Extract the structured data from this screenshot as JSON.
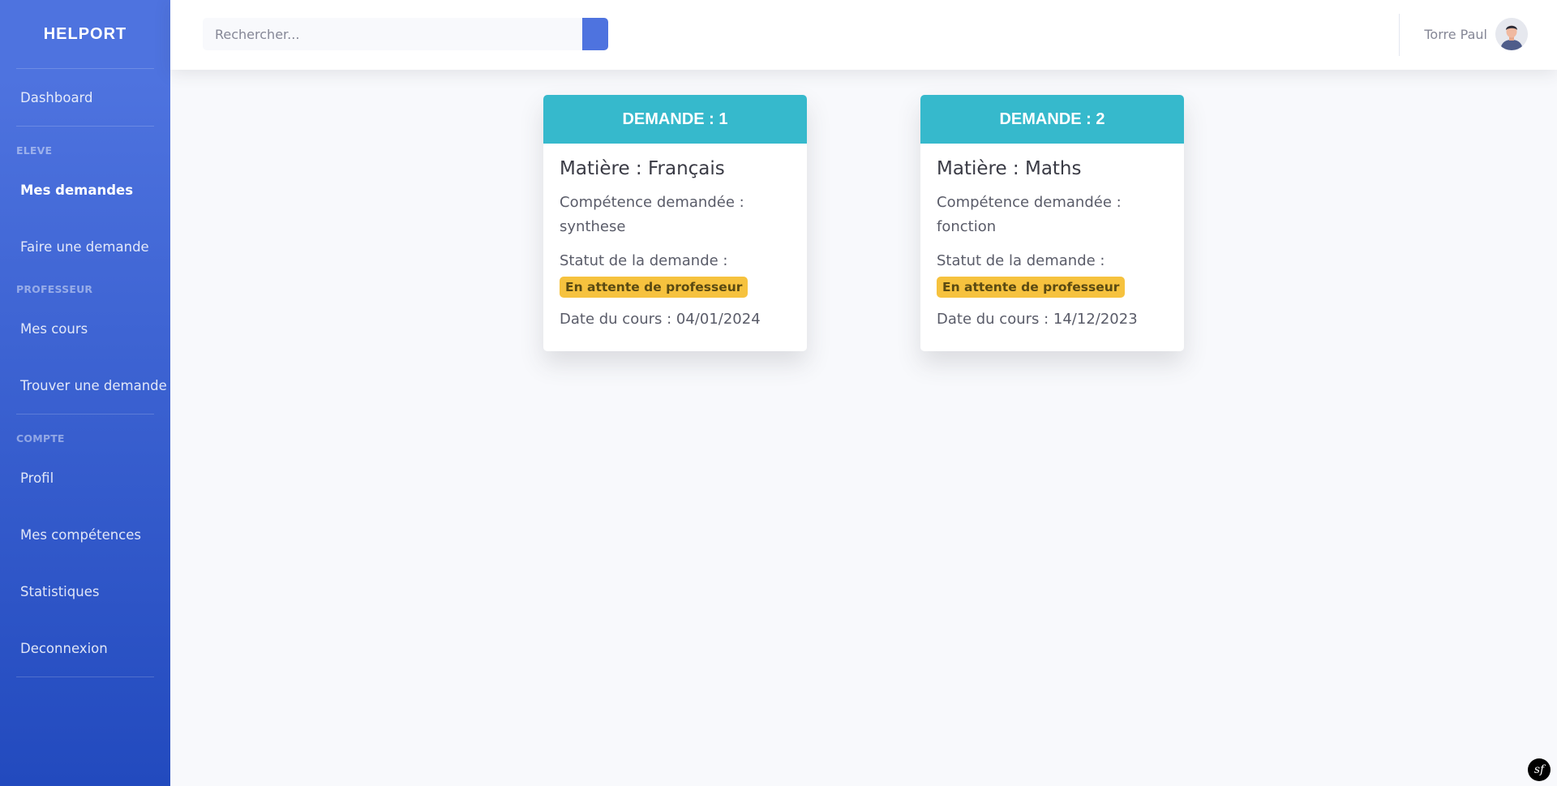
{
  "sidebar": {
    "brand": "HELPORT",
    "dashboard": "Dashboard",
    "eleve_heading": "ELEVE",
    "mes_demandes": "Mes demandes",
    "faire_demande": "Faire une demande",
    "professeur_heading": "PROFESSEUR",
    "mes_cours": "Mes cours",
    "trouver_demande": "Trouver une demande",
    "compte_heading": "COMPTE",
    "profil": "Profil",
    "mes_competences": "Mes compétences",
    "statistiques": "Statistiques",
    "deconnexion": "Deconnexion"
  },
  "topbar": {
    "search_placeholder": "Rechercher...",
    "user_name": "Torre Paul"
  },
  "cards": [
    {
      "header": "DEMANDE : 1",
      "subject": "Matière : Français",
      "competence_label": "Compétence demandée :",
      "competence_value": "synthese",
      "statut_label": "Statut de la demande :",
      "statut_badge": "En attente de professeur",
      "date": "Date du cours : 04/01/2024"
    },
    {
      "header": "DEMANDE : 2",
      "subject": "Matière : Maths",
      "competence_label": "Compétence demandée :",
      "competence_value": "fonction",
      "statut_label": "Statut de la demande :",
      "statut_badge": "En attente de professeur",
      "date": "Date du cours : 14/12/2023"
    }
  ],
  "colors": {
    "sidebar_top": "#4e73df",
    "sidebar_bottom": "#224abe",
    "card_header": "#36b9cc",
    "badge": "#f6c23e"
  },
  "footer": {
    "symfony_icon": "symfony-icon",
    "symfony_glyph": "sf"
  }
}
